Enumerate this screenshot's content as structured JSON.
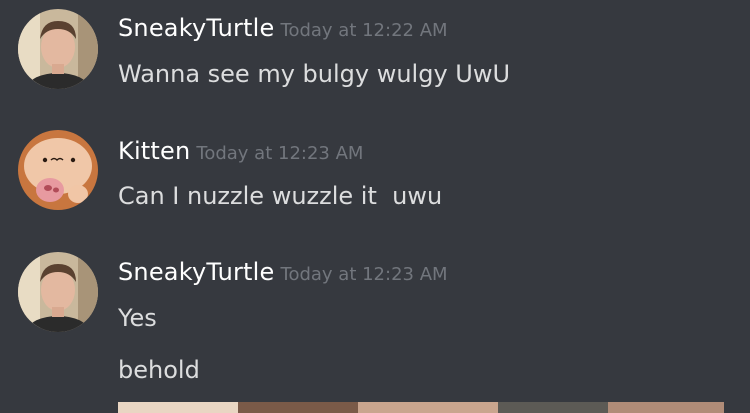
{
  "colors": {
    "background": "#36393f",
    "username": "#ffffff",
    "timestamp": "#72767d",
    "message_text": "#dcddde"
  },
  "messages": [
    {
      "username": "SneakyTurtle",
      "timestamp": "Today at 12:22 AM",
      "avatar": "person-avatar",
      "lines": [
        "Wanna see my bulgy wulgy UwU"
      ]
    },
    {
      "username": "Kitten",
      "timestamp": "Today at 12:23 AM",
      "avatar": "plush-toy-avatar",
      "lines": [
        "Can I nuzzle wuzzle it  uwu"
      ]
    },
    {
      "username": "SneakyTurtle",
      "timestamp": "Today at 12:23 AM",
      "avatar": "person-avatar",
      "lines": [
        "Yes",
        "behold"
      ],
      "attachment": "image-attachment"
    }
  ]
}
